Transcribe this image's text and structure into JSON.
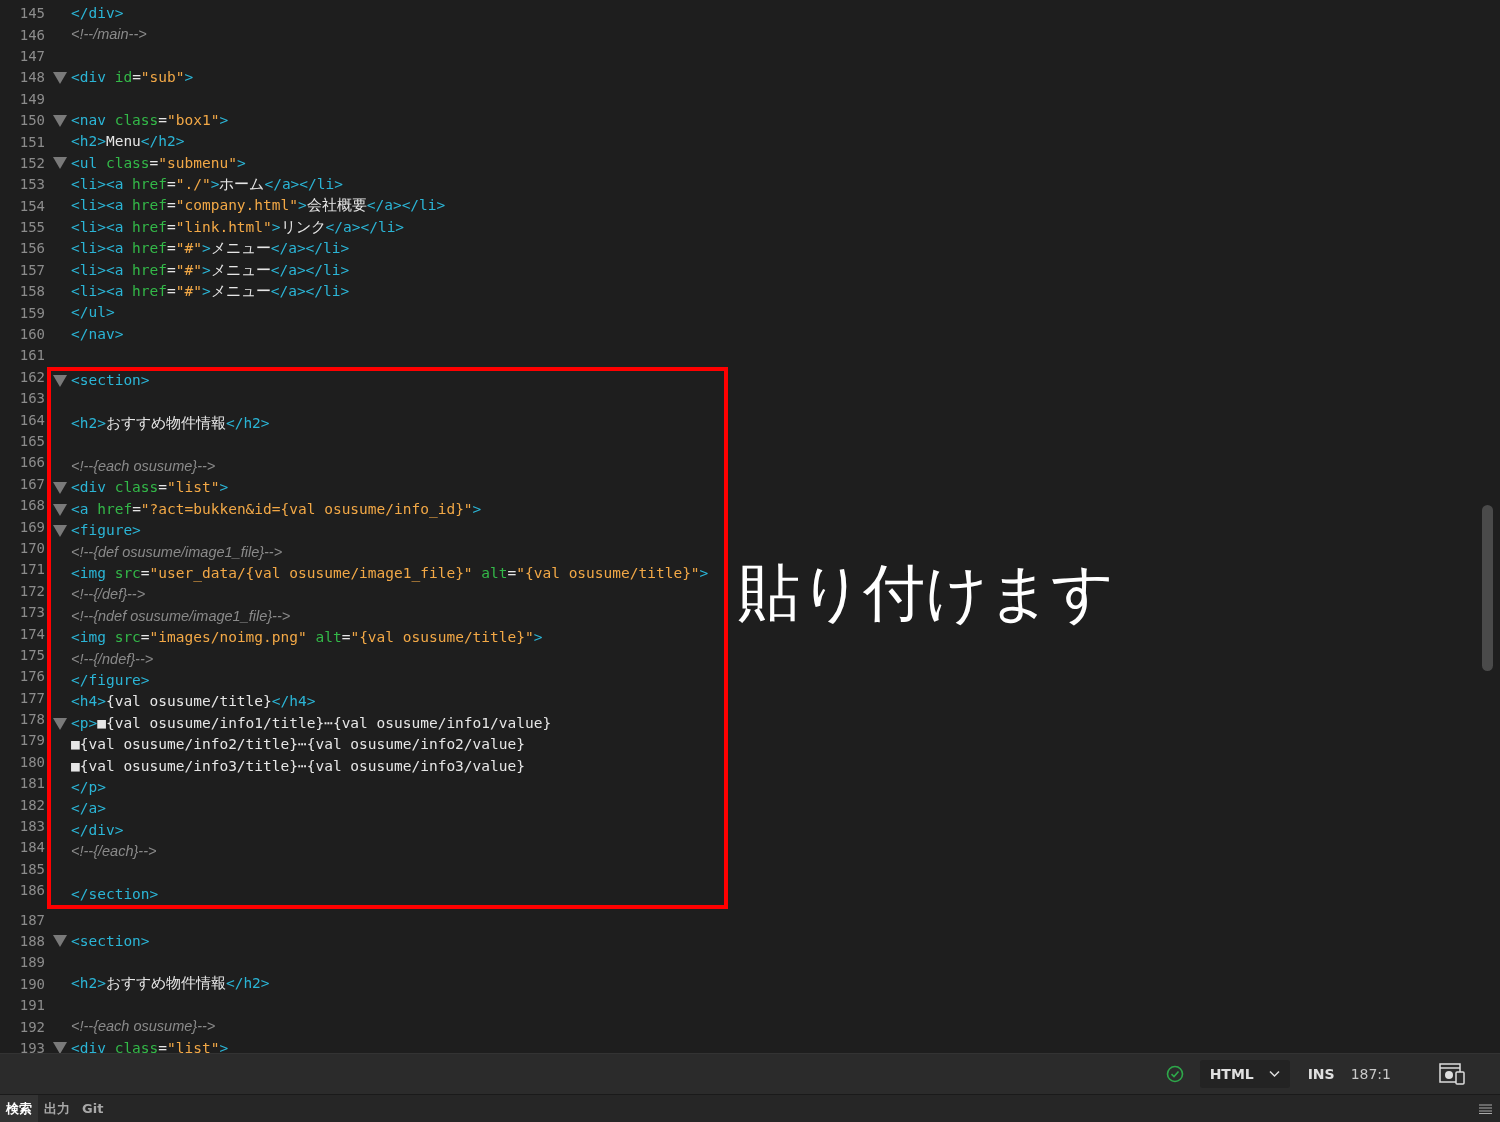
{
  "editor": {
    "blocks": [
      {
        "boxed": false,
        "lines": [
          {
            "number": "145",
            "fold": false,
            "tokens": [
              {
                "kind": "tag",
                "text": "</div>"
              }
            ]
          },
          {
            "number": "146",
            "fold": false,
            "tokens": [
              {
                "kind": "comment",
                "text": "<!--/main-->"
              }
            ]
          },
          {
            "number": "147",
            "fold": false
          },
          {
            "number": "148",
            "fold": true,
            "tokens": [
              {
                "kind": "tag",
                "text": "<div "
              },
              {
                "kind": "attr",
                "text": "id"
              },
              {
                "kind": "text",
                "text": "="
              },
              {
                "kind": "str",
                "text": "\"sub\""
              },
              {
                "kind": "tag",
                "text": ">"
              }
            ]
          },
          {
            "number": "149",
            "fold": false
          },
          {
            "number": "150",
            "fold": true,
            "tokens": [
              {
                "kind": "tag",
                "text": "<nav "
              },
              {
                "kind": "attr",
                "text": "class"
              },
              {
                "kind": "text",
                "text": "="
              },
              {
                "kind": "str",
                "text": "\"box1\""
              },
              {
                "kind": "tag",
                "text": ">"
              }
            ]
          },
          {
            "number": "151",
            "fold": false,
            "tokens": [
              {
                "kind": "tag",
                "text": "<h2>"
              },
              {
                "kind": "text",
                "text": "Menu"
              },
              {
                "kind": "tag",
                "text": "</h2>"
              }
            ]
          },
          {
            "number": "152",
            "fold": true,
            "tokens": [
              {
                "kind": "tag",
                "text": "<ul "
              },
              {
                "kind": "attr",
                "text": "class"
              },
              {
                "kind": "text",
                "text": "="
              },
              {
                "kind": "str",
                "text": "\"submenu\""
              },
              {
                "kind": "tag",
                "text": ">"
              }
            ]
          },
          {
            "number": "153",
            "fold": false,
            "tokens": [
              {
                "kind": "tag",
                "text": "<li><a "
              },
              {
                "kind": "attr",
                "text": "href"
              },
              {
                "kind": "text",
                "text": "="
              },
              {
                "kind": "str",
                "text": "\"./\""
              },
              {
                "kind": "tag",
                "text": ">"
              },
              {
                "kind": "text",
                "text": "ホーム"
              },
              {
                "kind": "tag",
                "text": "</a></li>"
              }
            ]
          },
          {
            "number": "154",
            "fold": false,
            "tokens": [
              {
                "kind": "tag",
                "text": "<li><a "
              },
              {
                "kind": "attr",
                "text": "href"
              },
              {
                "kind": "text",
                "text": "="
              },
              {
                "kind": "str",
                "text": "\"company.html\""
              },
              {
                "kind": "tag",
                "text": ">"
              },
              {
                "kind": "text",
                "text": "会社概要"
              },
              {
                "kind": "tag",
                "text": "</a></li>"
              }
            ]
          },
          {
            "number": "155",
            "fold": false,
            "tokens": [
              {
                "kind": "tag",
                "text": "<li><a "
              },
              {
                "kind": "attr",
                "text": "href"
              },
              {
                "kind": "text",
                "text": "="
              },
              {
                "kind": "str",
                "text": "\"link.html\""
              },
              {
                "kind": "tag",
                "text": ">"
              },
              {
                "kind": "text",
                "text": "リンク"
              },
              {
                "kind": "tag",
                "text": "</a></li>"
              }
            ]
          },
          {
            "number": "156",
            "fold": false,
            "tokens": [
              {
                "kind": "tag",
                "text": "<li><a "
              },
              {
                "kind": "attr",
                "text": "href"
              },
              {
                "kind": "text",
                "text": "="
              },
              {
                "kind": "str",
                "text": "\"#\""
              },
              {
                "kind": "tag",
                "text": ">"
              },
              {
                "kind": "text",
                "text": "メニュー"
              },
              {
                "kind": "tag",
                "text": "</a></li>"
              }
            ]
          },
          {
            "number": "157",
            "fold": false,
            "tokens": [
              {
                "kind": "tag",
                "text": "<li><a "
              },
              {
                "kind": "attr",
                "text": "href"
              },
              {
                "kind": "text",
                "text": "="
              },
              {
                "kind": "str",
                "text": "\"#\""
              },
              {
                "kind": "tag",
                "text": ">"
              },
              {
                "kind": "text",
                "text": "メニュー"
              },
              {
                "kind": "tag",
                "text": "</a></li>"
              }
            ]
          },
          {
            "number": "158",
            "fold": false,
            "tokens": [
              {
                "kind": "tag",
                "text": "<li><a "
              },
              {
                "kind": "attr",
                "text": "href"
              },
              {
                "kind": "text",
                "text": "="
              },
              {
                "kind": "str",
                "text": "\"#\""
              },
              {
                "kind": "tag",
                "text": ">"
              },
              {
                "kind": "text",
                "text": "メニュー"
              },
              {
                "kind": "tag",
                "text": "</a></li>"
              }
            ]
          },
          {
            "number": "159",
            "fold": false,
            "tokens": [
              {
                "kind": "tag",
                "text": "</ul>"
              }
            ]
          },
          {
            "number": "160",
            "fold": false,
            "tokens": [
              {
                "kind": "tag",
                "text": "</nav>"
              }
            ]
          },
          {
            "number": "161",
            "fold": false
          }
        ]
      },
      {
        "boxed": true,
        "annotation": "貼り付けます",
        "lines": [
          {
            "number": "162",
            "fold": true,
            "tokens": [
              {
                "kind": "tag",
                "text": "<section>"
              }
            ]
          },
          {
            "number": "163",
            "fold": false
          },
          {
            "number": "164",
            "fold": false,
            "tokens": [
              {
                "kind": "tag",
                "text": "<h2>"
              },
              {
                "kind": "text",
                "text": "おすすめ物件情報"
              },
              {
                "kind": "tag",
                "text": "</h2>"
              }
            ]
          },
          {
            "number": "165",
            "fold": false
          },
          {
            "number": "166",
            "fold": false,
            "tokens": [
              {
                "kind": "comment",
                "text": "<!--{each osusume}-->"
              }
            ]
          },
          {
            "number": "167",
            "fold": true,
            "tokens": [
              {
                "kind": "tag",
                "text": "<div "
              },
              {
                "kind": "attr",
                "text": "class"
              },
              {
                "kind": "text",
                "text": "="
              },
              {
                "kind": "str",
                "text": "\"list\""
              },
              {
                "kind": "tag",
                "text": ">"
              }
            ]
          },
          {
            "number": "168",
            "fold": true,
            "tokens": [
              {
                "kind": "tag",
                "text": "<a "
              },
              {
                "kind": "attr",
                "text": "href"
              },
              {
                "kind": "text",
                "text": "="
              },
              {
                "kind": "str",
                "text": "\"?act=bukken&id={val osusume/info_id}\""
              },
              {
                "kind": "tag",
                "text": ">"
              }
            ]
          },
          {
            "number": "169",
            "fold": true,
            "tokens": [
              {
                "kind": "tag",
                "text": "<figure>"
              }
            ]
          },
          {
            "number": "170",
            "fold": false,
            "tokens": [
              {
                "kind": "comment",
                "text": "<!--{def osusume/image1_file}-->"
              }
            ]
          },
          {
            "number": "171",
            "fold": false,
            "tokens": [
              {
                "kind": "tag",
                "text": "<img "
              },
              {
                "kind": "attr",
                "text": "src"
              },
              {
                "kind": "text",
                "text": "="
              },
              {
                "kind": "str",
                "text": "\"user_data/{val osusume/image1_file}\" "
              },
              {
                "kind": "attr",
                "text": "alt"
              },
              {
                "kind": "text",
                "text": "="
              },
              {
                "kind": "str",
                "text": "\"{val osusume/title}\""
              },
              {
                "kind": "tag",
                "text": ">"
              }
            ]
          },
          {
            "number": "172",
            "fold": false,
            "tokens": [
              {
                "kind": "comment",
                "text": "<!--{/def}-->"
              }
            ]
          },
          {
            "number": "173",
            "fold": false,
            "tokens": [
              {
                "kind": "comment",
                "text": "<!--{ndef osusume/image1_file}-->"
              }
            ]
          },
          {
            "number": "174",
            "fold": false,
            "tokens": [
              {
                "kind": "tag",
                "text": "<img "
              },
              {
                "kind": "attr",
                "text": "src"
              },
              {
                "kind": "text",
                "text": "="
              },
              {
                "kind": "str",
                "text": "\"images/noimg.png\" "
              },
              {
                "kind": "attr",
                "text": "alt"
              },
              {
                "kind": "text",
                "text": "="
              },
              {
                "kind": "str",
                "text": "\"{val osusume/title}\""
              },
              {
                "kind": "tag",
                "text": ">"
              }
            ]
          },
          {
            "number": "175",
            "fold": false,
            "tokens": [
              {
                "kind": "comment",
                "text": "<!--{/ndef}-->"
              }
            ]
          },
          {
            "number": "176",
            "fold": false,
            "tokens": [
              {
                "kind": "tag",
                "text": "</figure>"
              }
            ]
          },
          {
            "number": "177",
            "fold": false,
            "tokens": [
              {
                "kind": "tag",
                "text": "<h4>"
              },
              {
                "kind": "text",
                "text": "{val osusume/title}"
              },
              {
                "kind": "tag",
                "text": "</h4>"
              }
            ]
          },
          {
            "number": "178",
            "fold": true,
            "tokens": [
              {
                "kind": "tag",
                "text": "<p>"
              },
              {
                "kind": "text",
                "text": "■{val osusume/info1/title}⋯{val osusume/info1/value}"
              }
            ]
          },
          {
            "number": "179",
            "fold": false,
            "tokens": [
              {
                "kind": "text",
                "text": "■{val osusume/info2/title}⋯{val osusume/info2/value}"
              }
            ]
          },
          {
            "number": "180",
            "fold": false,
            "tokens": [
              {
                "kind": "text",
                "text": "■{val osusume/info3/title}⋯{val osusume/info3/value}"
              }
            ]
          },
          {
            "number": "181",
            "fold": false,
            "tokens": [
              {
                "kind": "tag",
                "text": "</p>"
              }
            ]
          },
          {
            "number": "182",
            "fold": false,
            "tokens": [
              {
                "kind": "tag",
                "text": "</a>"
              }
            ]
          },
          {
            "number": "183",
            "fold": false,
            "tokens": [
              {
                "kind": "tag",
                "text": "</div>"
              }
            ]
          },
          {
            "number": "184",
            "fold": false,
            "tokens": [
              {
                "kind": "comment",
                "text": "<!--{/each}-->"
              }
            ]
          },
          {
            "number": "185",
            "fold": false
          },
          {
            "number": "186",
            "fold": false,
            "tokens": [
              {
                "kind": "tag",
                "text": "</section>"
              }
            ]
          }
        ]
      },
      {
        "boxed": false,
        "lines": [
          {
            "number": "187",
            "fold": false
          },
          {
            "number": "188",
            "fold": true,
            "tokens": [
              {
                "kind": "tag",
                "text": "<section>"
              }
            ]
          },
          {
            "number": "189",
            "fold": false
          },
          {
            "number": "190",
            "fold": false,
            "tokens": [
              {
                "kind": "tag",
                "text": "<h2>"
              },
              {
                "kind": "text",
                "text": "おすすめ物件情報"
              },
              {
                "kind": "tag",
                "text": "</h2>"
              }
            ]
          },
          {
            "number": "191",
            "fold": false
          },
          {
            "number": "192",
            "fold": false,
            "tokens": [
              {
                "kind": "comment",
                "text": "<!--{each osusume}-->"
              }
            ]
          },
          {
            "number": "193",
            "fold": true,
            "tokens": [
              {
                "kind": "tag",
                "text": "<div "
              },
              {
                "kind": "attr",
                "text": "class"
              },
              {
                "kind": "text",
                "text": "="
              },
              {
                "kind": "str",
                "text": "\"list\""
              },
              {
                "kind": "tag",
                "text": ">"
              }
            ]
          }
        ]
      }
    ]
  },
  "status_bar": {
    "language": "HTML",
    "mode": "INS",
    "position": "187:1"
  },
  "panel_tabs": [
    {
      "label": "検索",
      "selected": true
    },
    {
      "label": "出力",
      "selected": false
    },
    {
      "label": "Git",
      "selected": false
    }
  ]
}
